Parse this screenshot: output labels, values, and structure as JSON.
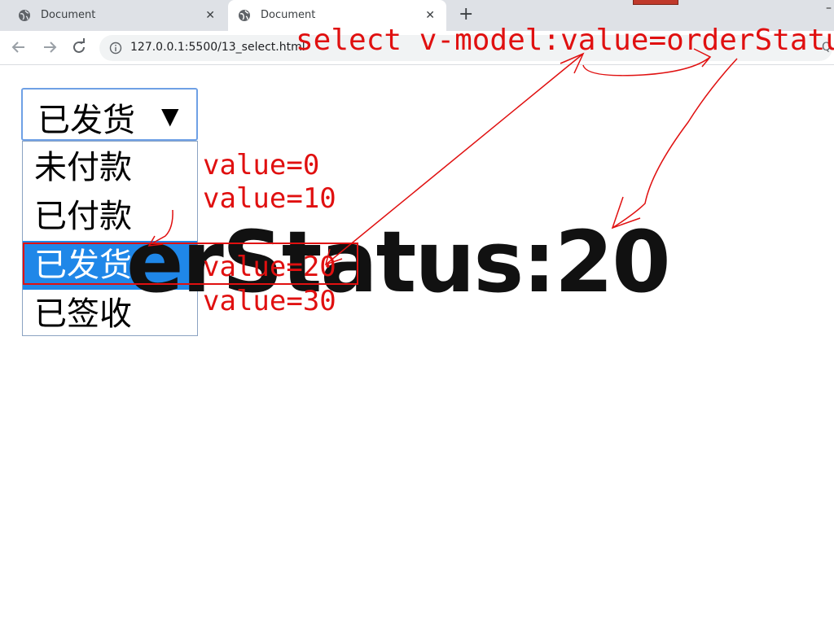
{
  "browser": {
    "tabs": [
      {
        "title": "Document",
        "active": false
      },
      {
        "title": "Document",
        "active": true
      }
    ],
    "url": "127.0.0.1:5500/13_select.html"
  },
  "page": {
    "select": {
      "selected_label": "已发货",
      "options": [
        {
          "label": "未付款",
          "selected": false
        },
        {
          "label": "已付款",
          "selected": false
        },
        {
          "label": "已发货",
          "selected": true
        },
        {
          "label": "已签收",
          "selected": false
        }
      ]
    },
    "output_text": "erStatus:20"
  },
  "annotations": {
    "title": "select v-model:value=orderStatu",
    "values": [
      "value=0",
      "value=10",
      "value=20",
      "value=30"
    ],
    "color": "#e01010"
  },
  "colors": {
    "selected_option_bg": "#1f87e8",
    "select_focus_border": "#6fa0e5"
  }
}
